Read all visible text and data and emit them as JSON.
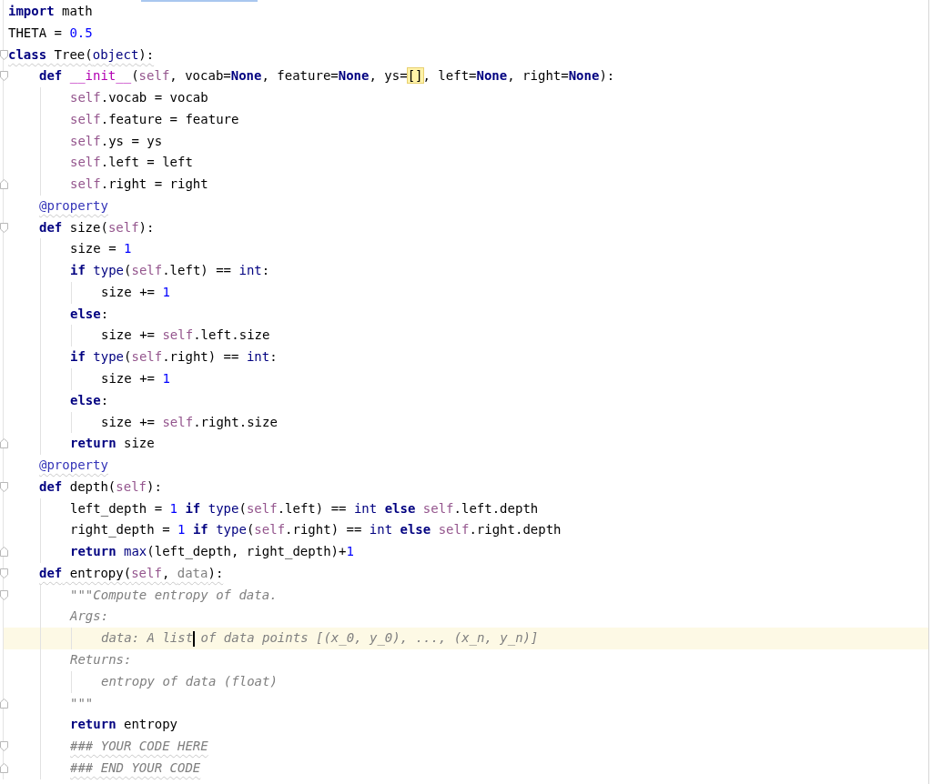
{
  "editor": {
    "lines": [
      {
        "current": false,
        "warning": false,
        "fold_start": false,
        "fold_end": false,
        "tokens": [
          {
            "kind": "kw",
            "text": "import"
          },
          {
            "kind": "plain",
            "text": " math"
          }
        ]
      },
      {
        "current": false,
        "warning": false,
        "fold_start": false,
        "fold_end": false,
        "tokens": [
          {
            "kind": "plain",
            "text": "THETA = "
          },
          {
            "kind": "num",
            "text": "0.5"
          }
        ]
      },
      {
        "current": false,
        "warning": true,
        "fold_start": true,
        "fold_end": false,
        "tokens": [
          {
            "kind": "kw",
            "text": "class"
          },
          {
            "kind": "plain",
            "text": " Tree("
          },
          {
            "kind": "builtin",
            "text": "object"
          },
          {
            "kind": "plain",
            "text": "):"
          }
        ],
        "children": [
          {
            "current": false,
            "warning": false,
            "fold_start": true,
            "fold_end": false,
            "tokens": [
              {
                "kind": "kw",
                "text": "def"
              },
              {
                "kind": "magic",
                "text": " __init__"
              },
              {
                "kind": "plain",
                "text": "("
              },
              {
                "kind": "self",
                "text": "self"
              },
              {
                "kind": "plain",
                "text": ", vocab="
              },
              {
                "kind": "kw",
                "text": "None"
              },
              {
                "kind": "plain",
                "text": ", feature="
              },
              {
                "kind": "kw",
                "text": "None"
              },
              {
                "kind": "plain",
                "text": ", ys="
              },
              {
                "kind": "matched",
                "text": "[]"
              },
              {
                "kind": "plain",
                "text": ", left="
              },
              {
                "kind": "kw",
                "text": "None"
              },
              {
                "kind": "plain",
                "text": ", right="
              },
              {
                "kind": "kw",
                "text": "None"
              },
              {
                "kind": "plain",
                "text": "):"
              }
            ],
            "children": [
              {
                "current": false,
                "warning": false,
                "fold_start": false,
                "fold_end": false,
                "tokens": [
                  {
                    "kind": "self",
                    "text": "self"
                  },
                  {
                    "kind": "plain",
                    "text": ".vocab = vocab"
                  }
                ]
              },
              {
                "current": false,
                "warning": false,
                "fold_start": false,
                "fold_end": false,
                "tokens": [
                  {
                    "kind": "self",
                    "text": "self"
                  },
                  {
                    "kind": "plain",
                    "text": ".feature = feature"
                  }
                ]
              },
              {
                "current": false,
                "warning": false,
                "fold_start": false,
                "fold_end": false,
                "tokens": [
                  {
                    "kind": "self",
                    "text": "self"
                  },
                  {
                    "kind": "plain",
                    "text": ".ys = ys"
                  }
                ]
              },
              {
                "current": false,
                "warning": false,
                "fold_start": false,
                "fold_end": false,
                "tokens": [
                  {
                    "kind": "self",
                    "text": "self"
                  },
                  {
                    "kind": "plain",
                    "text": ".left = left"
                  }
                ]
              },
              {
                "current": false,
                "warning": false,
                "fold_start": false,
                "fold_end": true,
                "tokens": [
                  {
                    "kind": "self",
                    "text": "self"
                  },
                  {
                    "kind": "plain",
                    "text": ".right = right"
                  }
                ]
              }
            ]
          },
          {
            "current": false,
            "warning": true,
            "fold_start": false,
            "fold_end": false,
            "tokens": [
              {
                "kind": "deco",
                "text": "@property"
              }
            ]
          },
          {
            "current": false,
            "warning": false,
            "fold_start": true,
            "fold_end": false,
            "tokens": [
              {
                "kind": "kw",
                "text": "def"
              },
              {
                "kind": "plain",
                "text": " size("
              },
              {
                "kind": "self",
                "text": "self"
              },
              {
                "kind": "plain",
                "text": "):"
              }
            ],
            "children": [
              {
                "current": false,
                "warning": false,
                "fold_start": false,
                "fold_end": false,
                "tokens": [
                  {
                    "kind": "plain",
                    "text": "size = "
                  },
                  {
                    "kind": "num",
                    "text": "1"
                  }
                ]
              },
              {
                "current": false,
                "warning": false,
                "fold_start": false,
                "fold_end": false,
                "tokens": [
                  {
                    "kind": "kw",
                    "text": "if"
                  },
                  {
                    "kind": "builtin",
                    "text": " type"
                  },
                  {
                    "kind": "plain",
                    "text": "("
                  },
                  {
                    "kind": "self",
                    "text": "self"
                  },
                  {
                    "kind": "plain",
                    "text": ".left) == "
                  },
                  {
                    "kind": "builtin",
                    "text": "int"
                  },
                  {
                    "kind": "plain",
                    "text": ":"
                  }
                ],
                "children": [
                  {
                    "current": false,
                    "warning": false,
                    "fold_start": false,
                    "fold_end": false,
                    "tokens": [
                      {
                        "kind": "plain",
                        "text": "size += "
                      },
                      {
                        "kind": "num",
                        "text": "1"
                      }
                    ]
                  }
                ]
              },
              {
                "current": false,
                "warning": false,
                "fold_start": false,
                "fold_end": false,
                "tokens": [
                  {
                    "kind": "kw",
                    "text": "else"
                  },
                  {
                    "kind": "plain",
                    "text": ":"
                  }
                ],
                "children": [
                  {
                    "current": false,
                    "warning": false,
                    "fold_start": false,
                    "fold_end": false,
                    "tokens": [
                      {
                        "kind": "plain",
                        "text": "size += "
                      },
                      {
                        "kind": "self",
                        "text": "self"
                      },
                      {
                        "kind": "plain",
                        "text": ".left.size"
                      }
                    ]
                  }
                ]
              },
              {
                "current": false,
                "warning": false,
                "fold_start": false,
                "fold_end": false,
                "tokens": [
                  {
                    "kind": "kw",
                    "text": "if"
                  },
                  {
                    "kind": "builtin",
                    "text": " type"
                  },
                  {
                    "kind": "plain",
                    "text": "("
                  },
                  {
                    "kind": "self",
                    "text": "self"
                  },
                  {
                    "kind": "plain",
                    "text": ".right) == "
                  },
                  {
                    "kind": "builtin",
                    "text": "int"
                  },
                  {
                    "kind": "plain",
                    "text": ":"
                  }
                ],
                "children": [
                  {
                    "current": false,
                    "warning": false,
                    "fold_start": false,
                    "fold_end": false,
                    "tokens": [
                      {
                        "kind": "plain",
                        "text": "size += "
                      },
                      {
                        "kind": "num",
                        "text": "1"
                      }
                    ]
                  }
                ]
              },
              {
                "current": false,
                "warning": false,
                "fold_start": false,
                "fold_end": false,
                "tokens": [
                  {
                    "kind": "kw",
                    "text": "else"
                  },
                  {
                    "kind": "plain",
                    "text": ":"
                  }
                ],
                "children": [
                  {
                    "current": false,
                    "warning": false,
                    "fold_start": false,
                    "fold_end": false,
                    "tokens": [
                      {
                        "kind": "plain",
                        "text": "size += "
                      },
                      {
                        "kind": "self",
                        "text": "self"
                      },
                      {
                        "kind": "plain",
                        "text": ".right.size"
                      }
                    ]
                  }
                ]
              },
              {
                "current": false,
                "warning": false,
                "fold_start": false,
                "fold_end": true,
                "tokens": [
                  {
                    "kind": "kw",
                    "text": "return"
                  },
                  {
                    "kind": "plain",
                    "text": " size"
                  }
                ]
              }
            ]
          },
          {
            "current": false,
            "warning": true,
            "fold_start": false,
            "fold_end": false,
            "tokens": [
              {
                "kind": "deco",
                "text": "@property"
              }
            ]
          },
          {
            "current": false,
            "warning": false,
            "fold_start": true,
            "fold_end": false,
            "tokens": [
              {
                "kind": "kw",
                "text": "def"
              },
              {
                "kind": "plain",
                "text": " depth("
              },
              {
                "kind": "self",
                "text": "self"
              },
              {
                "kind": "plain",
                "text": "):"
              }
            ],
            "children": [
              {
                "current": false,
                "warning": false,
                "fold_start": false,
                "fold_end": false,
                "tokens": [
                  {
                    "kind": "plain",
                    "text": "left_depth = "
                  },
                  {
                    "kind": "num",
                    "text": "1"
                  },
                  {
                    "kind": "kw",
                    "text": " if"
                  },
                  {
                    "kind": "builtin",
                    "text": " type"
                  },
                  {
                    "kind": "plain",
                    "text": "("
                  },
                  {
                    "kind": "self",
                    "text": "self"
                  },
                  {
                    "kind": "plain",
                    "text": ".left) == "
                  },
                  {
                    "kind": "builtin",
                    "text": "int"
                  },
                  {
                    "kind": "kw",
                    "text": " else"
                  },
                  {
                    "kind": "self",
                    "text": " self"
                  },
                  {
                    "kind": "plain",
                    "text": ".left.depth"
                  }
                ]
              },
              {
                "current": false,
                "warning": false,
                "fold_start": false,
                "fold_end": false,
                "tokens": [
                  {
                    "kind": "plain",
                    "text": "right_depth = "
                  },
                  {
                    "kind": "num",
                    "text": "1"
                  },
                  {
                    "kind": "kw",
                    "text": " if"
                  },
                  {
                    "kind": "builtin",
                    "text": " type"
                  },
                  {
                    "kind": "plain",
                    "text": "("
                  },
                  {
                    "kind": "self",
                    "text": "self"
                  },
                  {
                    "kind": "plain",
                    "text": ".right) == "
                  },
                  {
                    "kind": "builtin",
                    "text": "int"
                  },
                  {
                    "kind": "kw",
                    "text": " else"
                  },
                  {
                    "kind": "self",
                    "text": " self"
                  },
                  {
                    "kind": "plain",
                    "text": ".right.depth"
                  }
                ]
              },
              {
                "current": false,
                "warning": false,
                "fold_start": false,
                "fold_end": true,
                "tokens": [
                  {
                    "kind": "kw",
                    "text": "return"
                  },
                  {
                    "kind": "builtin",
                    "text": " max"
                  },
                  {
                    "kind": "plain",
                    "text": "(left_depth, right_depth)+"
                  },
                  {
                    "kind": "num",
                    "text": "1"
                  }
                ]
              }
            ]
          },
          {
            "current": false,
            "warning": true,
            "fold_start": true,
            "fold_end": false,
            "tokens": [
              {
                "kind": "kw",
                "text": "def"
              },
              {
                "kind": "plain",
                "text": " entropy("
              },
              {
                "kind": "self",
                "text": "self"
              },
              {
                "kind": "plain",
                "text": ", "
              },
              {
                "kind": "unused",
                "text": "data"
              },
              {
                "kind": "plain",
                "text": "):"
              }
            ],
            "children": [
              {
                "current": false,
                "warning": false,
                "fold_start": true,
                "fold_end": false,
                "tokens": [
                  {
                    "kind": "doc",
                    "text": "\"\"\"Compute entropy of data."
                  }
                ]
              },
              {
                "current": false,
                "warning": false,
                "fold_start": false,
                "fold_end": false,
                "tokens": [
                  {
                    "kind": "doc",
                    "text": "Args:"
                  }
                ],
                "children": [
                  {
                    "current": true,
                    "warning": false,
                    "fold_start": false,
                    "fold_end": false,
                    "tokens": [
                      {
                        "kind": "doc",
                        "text": "data: A list"
                      },
                      {
                        "kind": "caret"
                      },
                      {
                        "kind": "doc",
                        "text": " of data points [(x_0, y_0), ..., (x_n, y_n)]"
                      }
                    ]
                  }
                ]
              },
              {
                "current": false,
                "warning": false,
                "fold_start": false,
                "fold_end": false,
                "tokens": [
                  {
                    "kind": "doc",
                    "text": "Returns:"
                  }
                ],
                "children": [
                  {
                    "current": false,
                    "warning": false,
                    "fold_start": false,
                    "fold_end": false,
                    "tokens": [
                      {
                        "kind": "doc",
                        "text": "entropy of data (float)"
                      }
                    ]
                  }
                ]
              },
              {
                "current": false,
                "warning": false,
                "fold_start": false,
                "fold_end": true,
                "tokens": [
                  {
                    "kind": "doc",
                    "text": "\"\"\""
                  }
                ]
              },
              {
                "current": false,
                "warning": false,
                "fold_start": false,
                "fold_end": false,
                "tokens": [
                  {
                    "kind": "kw",
                    "text": "return"
                  },
                  {
                    "kind": "plain",
                    "text": " entropy"
                  }
                ]
              },
              {
                "current": false,
                "warning": true,
                "fold_start": true,
                "fold_end": false,
                "tokens": [
                  {
                    "kind": "doc",
                    "text": "### YOUR CODE HERE"
                  }
                ]
              },
              {
                "current": false,
                "warning": true,
                "fold_start": false,
                "fold_end": true,
                "tokens": [
                  {
                    "kind": "doc",
                    "text": "### END YOUR CODE"
                  }
                ]
              }
            ]
          }
        ]
      }
    ]
  }
}
